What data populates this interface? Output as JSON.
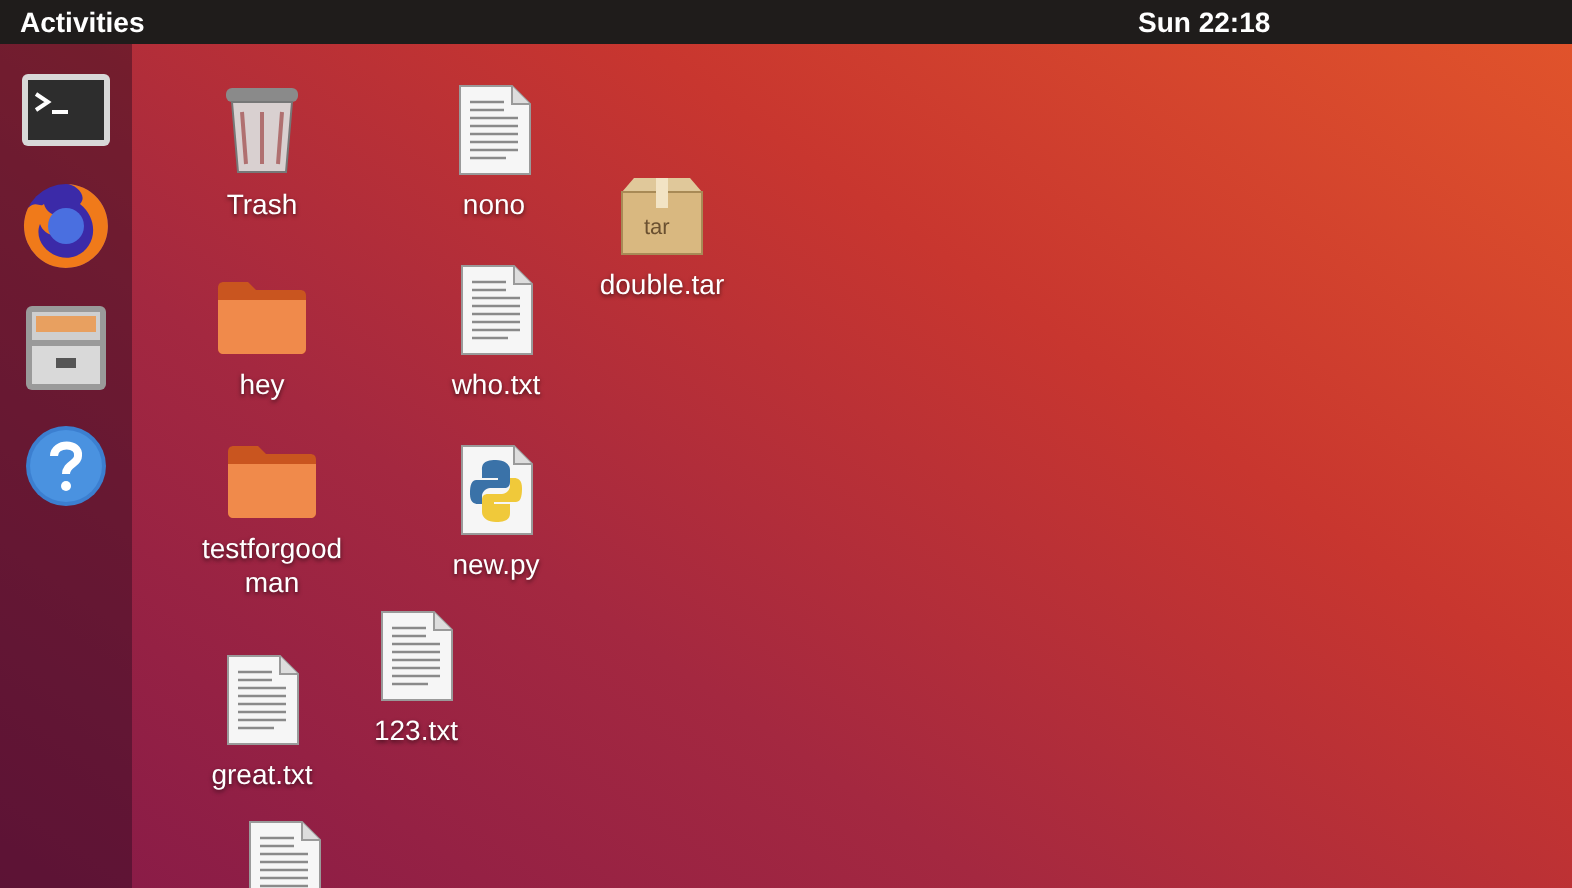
{
  "top_bar": {
    "activities": "Activities",
    "clock": "Sun 22:18"
  },
  "dock": [
    {
      "kind": "terminal"
    },
    {
      "kind": "browser"
    },
    {
      "kind": "files"
    },
    {
      "kind": "help"
    }
  ],
  "desktop_items": [
    {
      "kind": "trash",
      "label": "Trash"
    },
    {
      "kind": "text",
      "label": "nono"
    },
    {
      "kind": "archive",
      "label": "double.tar",
      "badge": "tar"
    },
    {
      "kind": "folder",
      "label": "hey"
    },
    {
      "kind": "text",
      "label": "who.txt"
    },
    {
      "kind": "folder",
      "label": "testforgoodman"
    },
    {
      "kind": "python",
      "label": "new.py"
    },
    {
      "kind": "text",
      "label": "123.txt"
    },
    {
      "kind": "text",
      "label": "great.txt"
    },
    {
      "kind": "text"
    }
  ]
}
